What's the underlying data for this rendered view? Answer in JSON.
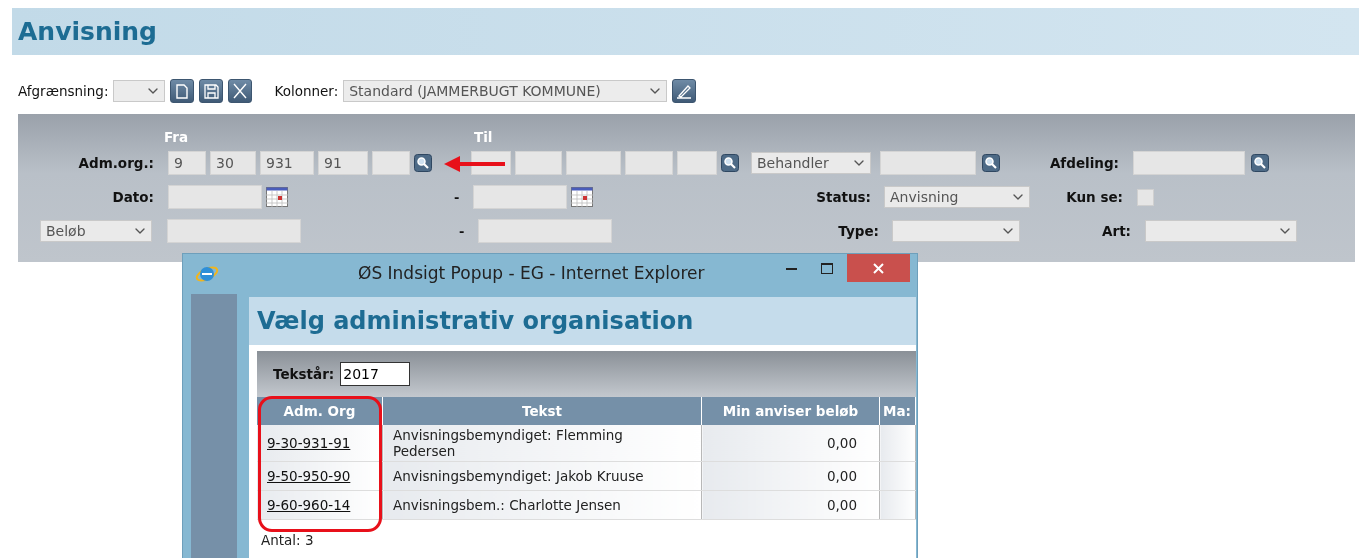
{
  "page_title": "Anvisning",
  "toolbar": {
    "afgraensning_label": "Afgrænsning:",
    "kolonner_label": "Kolonner:",
    "kolonner_value": "Standard (JAMMERBUGT KOMMUNE)"
  },
  "filter": {
    "fra_label": "Fra",
    "til_label": "Til",
    "adm_org": {
      "label": "Adm.org.:",
      "from_values": [
        "9",
        "30",
        "931",
        "91"
      ]
    },
    "behandler": {
      "value": "Behandler"
    },
    "afdeling": {
      "label": "Afdeling:"
    },
    "dato": {
      "label": "Dato:",
      "separator": "-"
    },
    "status": {
      "label": "Status:",
      "value": "Anvisning"
    },
    "kun_se": {
      "label": "Kun se:",
      "checked": false
    },
    "beloeb": {
      "value": "Beløb",
      "separator": "-"
    },
    "type": {
      "label": "Type:"
    },
    "art": {
      "label": "Art:"
    }
  },
  "popup": {
    "window_title": "ØS Indsigt Popup - EG - Internet Explorer",
    "heading": "Vælg administrativ organisation",
    "tekstaar": {
      "label": "Tekstår:",
      "value": "2017"
    },
    "columns": [
      "Adm. Org",
      "Tekst",
      "Min anviser beløb",
      "Ma:"
    ],
    "rows": [
      {
        "org": "9-30-931-91",
        "tekst": "Anvisningsbemyndiget: Flemming Pedersen",
        "min": "0,00"
      },
      {
        "org": "9-50-950-90",
        "tekst": "Anvisningsbemyndiget: Jakob Kruuse",
        "min": "0,00"
      },
      {
        "org": "9-60-960-14",
        "tekst": "Anvisningsbem.: Charlotte Jensen",
        "min": "0,00"
      }
    ],
    "count": "Antal: 3"
  }
}
